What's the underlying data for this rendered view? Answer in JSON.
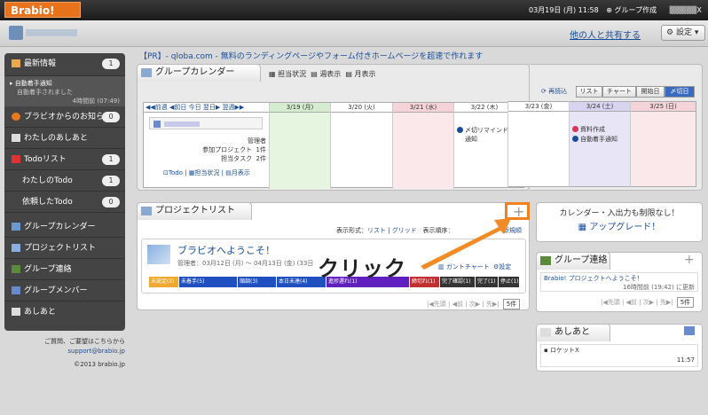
{
  "topbar": {
    "logo": "Brabio!",
    "date": "03月19日 (月) 11:58",
    "group_create": "グループ作成",
    "user": "X"
  },
  "subheader": {
    "share": "他の人と共有する",
    "settings": "設定"
  },
  "sidebar": {
    "latest": "最新情報",
    "latest_count": "1",
    "auto_notice": "自動着手通知",
    "auto_notice_sub": "自動着手されました",
    "auto_notice_time": "4時間前 (07:49)",
    "notice": "ブラビオからのお知らせ",
    "notice_count": "0",
    "footprint": "わたしのあしあと",
    "todo": "Todoリスト",
    "todo_count": "1",
    "my_todo": "わたしのTodo",
    "my_todo_count": "1",
    "req_todo": "依頼したTodo",
    "req_todo_count": "0",
    "group_cal": "グループカレンダー",
    "project_list": "プロジェクトリスト",
    "group_contact": "グループ連絡",
    "group_member": "グループメンバー",
    "ashiato": "あしあと"
  },
  "footer": {
    "q": "ご質問、ご要望はこちらから",
    "mail": "support@brabio.jp",
    "copy": "©2013 brabio.jp"
  },
  "pr": "【PR】- qloba.com - 無料のランディングページやフォーム付きホームページを超速で作れます",
  "calendar": {
    "title": "グループカレンダー",
    "tabs": [
      "担当状況",
      "週表示",
      "月表示"
    ],
    "reload": "再読込",
    "views": [
      "リスト",
      "チャート",
      "開始日",
      "〆切日"
    ],
    "nav": [
      "前週",
      "前日",
      "今日",
      "翌日",
      "翌週"
    ],
    "days": [
      "3/19 (月)",
      "3/20 (火)",
      "3/21 (水)",
      "3/22 (木)",
      "3/23 (金)",
      "3/24 (土)",
      "3/25 (日)"
    ],
    "role": "管理者",
    "proj_label": "参加プロジェクト",
    "proj_val": "1件",
    "task_label": "担当タスク",
    "task_val": "2件",
    "links": [
      "Todo",
      "担当状況",
      "月表示"
    ],
    "ev1": "〆切リマインド",
    "ev1b": "通知",
    "ev2": "資料作成",
    "ev3": "自動着手通知"
  },
  "projects": {
    "title": "プロジェクトリスト",
    "format_label": "表示形式：",
    "list": "リスト",
    "grid": "グリッド",
    "order": "表示順序：",
    "new": "新規順",
    "name": "ブラビオへようこそ！",
    "meta": "管理者：03月12日 (月) 〜 04月13日 (金) (33日",
    "gantt": "ガントチャート",
    "setting": "設定",
    "status": [
      "未設定(2)",
      "未着手(5)",
      "順調(3)",
      "本日未達(4)",
      "進捗遅れ(1)",
      "締切れ(1)",
      "完了確認(1)",
      "完了(1)",
      "停止(1)"
    ],
    "pager_prev": "先頭",
    "pager_back": "前",
    "pager_next": "次",
    "pager_last": "先",
    "per": "5件"
  },
  "upgrade": {
    "line1": "カレンダー・入出力も制限なし！",
    "line2": "アップグレード！"
  },
  "group_contact": {
    "title": "グループ連絡",
    "msg": "Brabio! プロジェクトへようこそ！",
    "time": "16時間前 (19:42) に更新",
    "per": "5件"
  },
  "ashiato": {
    "title": "あしあと",
    "item": "ロケットX",
    "time": "11:57"
  },
  "annotation": {
    "click": "クリック"
  },
  "colors": {
    "accent": "#e8731c",
    "link": "#1a4d99"
  }
}
